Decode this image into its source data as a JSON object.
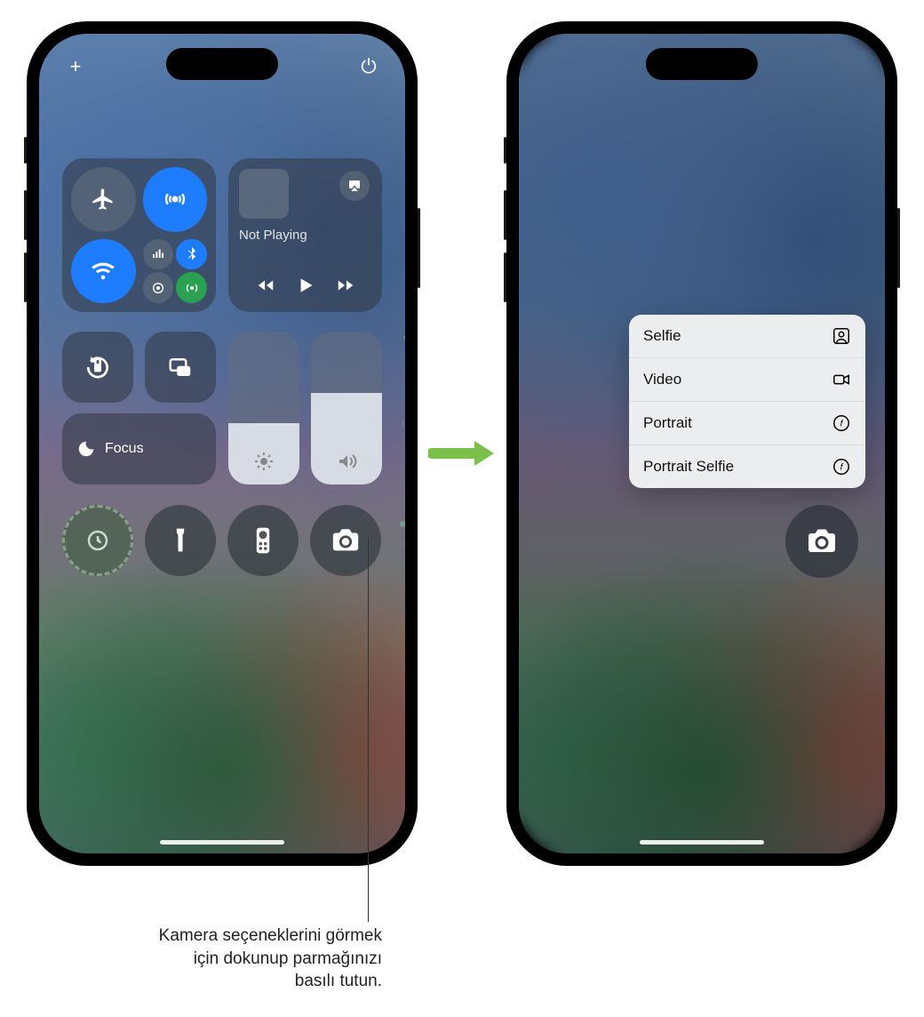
{
  "topbar": {
    "add_label": "+",
    "power_label": "⏻"
  },
  "connectivity": {
    "airplane": "Airplane Mode",
    "airdrop": "AirDrop",
    "wifi": "Wi-Fi",
    "cellular": "Cellular",
    "bluetooth": "Bluetooth",
    "hotspot": "Hotspot"
  },
  "media": {
    "now_playing_label": "Not Playing",
    "airplay": "AirPlay"
  },
  "controls": {
    "orientation_lock": "Orientation Lock",
    "screen_mirroring": "Screen Mirroring",
    "focus_label": "Focus",
    "brightness_pct": 40,
    "volume_pct": 60
  },
  "favorites_side": [
    "favorite-icon",
    "music-icon",
    "signal-icon"
  ],
  "bottom_row": [
    {
      "name": "timer-button",
      "icon": "timer-icon"
    },
    {
      "name": "flashlight-button",
      "icon": "flashlight-icon"
    },
    {
      "name": "remote-button",
      "icon": "apple-tv-remote-icon"
    },
    {
      "name": "camera-button",
      "icon": "camera-icon"
    }
  ],
  "camera_menu": {
    "items": [
      {
        "label": "Selfie",
        "icon": "person-square-icon"
      },
      {
        "label": "Video",
        "icon": "video-icon"
      },
      {
        "label": "Portrait",
        "icon": "aperture-icon"
      },
      {
        "label": "Portrait Selfie",
        "icon": "aperture-icon"
      }
    ]
  },
  "callout": {
    "text": "Kamera seçeneklerini görmek için dokunup parmağınızı basılı tutun."
  }
}
